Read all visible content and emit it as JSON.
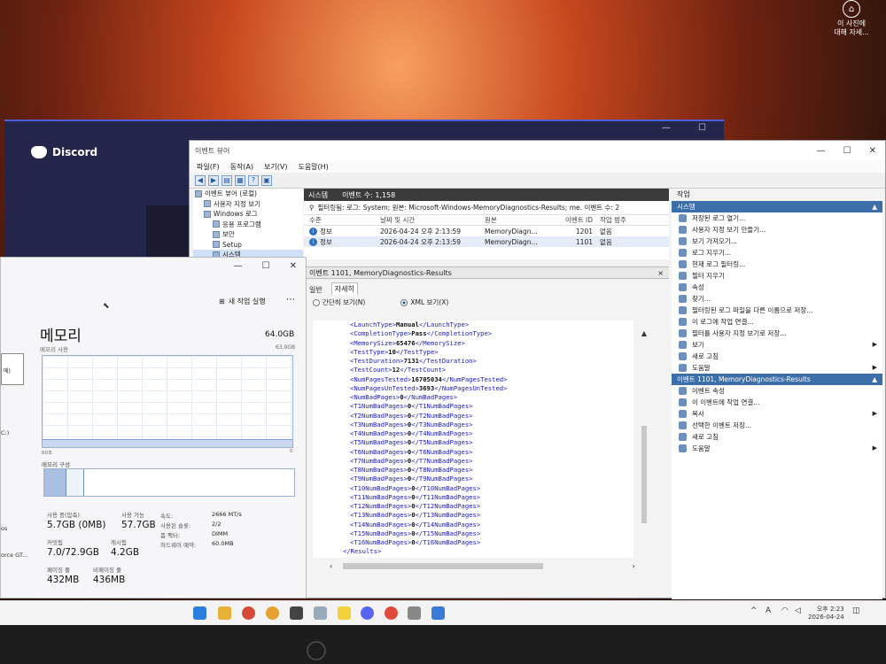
{
  "photo_caption": {
    "line1": "이 사진에",
    "line2": "대해 자세..."
  },
  "discord": {
    "app_name": "Discord"
  },
  "event_viewer": {
    "title": "이벤트 뷰어",
    "menu": [
      "파일(F)",
      "동작(A)",
      "보기(V)",
      "도움말(H)"
    ],
    "tree": [
      {
        "label": "이벤트 뷰어 (로컬)",
        "indent": 0,
        "selected": false
      },
      {
        "label": "사용자 지정 보기",
        "indent": 1,
        "selected": false
      },
      {
        "label": "Windows 로그",
        "indent": 1,
        "selected": false
      },
      {
        "label": "응용 프로그램",
        "indent": 2,
        "selected": false
      },
      {
        "label": "보안",
        "indent": 2,
        "selected": false
      },
      {
        "label": "Setup",
        "indent": 2,
        "selected": false
      },
      {
        "label": "시스템",
        "indent": 2,
        "selected": true
      }
    ],
    "section": {
      "name": "시스템",
      "count": "이벤트 수: 1,158"
    },
    "filter_text": "필터링됨: 로그: System; 원본: Microsoft-Windows-MemoryDiagnostics-Results; me. 이벤트 수: 2",
    "columns": [
      "수준",
      "날짜 및 시간",
      "원본",
      "이벤트 ID",
      "작업 범주"
    ],
    "rows": [
      {
        "level": "정보",
        "datetime": "2026-04-24 오후 2:13:59",
        "source": "MemoryDiagn...",
        "id": "1201",
        "category": "없음"
      },
      {
        "level": "정보",
        "datetime": "2026-04-24 오후 2:13:59",
        "source": "MemoryDiagn...",
        "id": "1101",
        "category": "없음"
      }
    ],
    "detail_title": "이벤트 1101, MemoryDiagnostics-Results",
    "detail_close": "×",
    "tabs": [
      "일반",
      "자세히"
    ],
    "view_modes": {
      "friendly": "간단히 보기(N)",
      "xml": "XML 보기(X)"
    },
    "xml_lines": [
      {
        "tag": "LaunchType",
        "value": "Manual"
      },
      {
        "tag": "CompletionType",
        "value": "Pass"
      },
      {
        "tag": "MemorySize",
        "value": "65476"
      },
      {
        "tag": "TestType",
        "value": "10"
      },
      {
        "tag": "TestDuration",
        "value": "7131"
      },
      {
        "tag": "TestCount",
        "value": "12"
      },
      {
        "tag": "NumPagesTested",
        "value": "16705034"
      },
      {
        "tag": "NumPagesUnTested",
        "value": "3693"
      },
      {
        "tag": "NumBadPages",
        "value": "0"
      },
      {
        "tag": "T1NumBadPages",
        "value": "0"
      },
      {
        "tag": "T2NumBadPages",
        "value": "0"
      },
      {
        "tag": "T3NumBadPages",
        "value": "0"
      },
      {
        "tag": "T4NumBadPages",
        "value": "0"
      },
      {
        "tag": "T5NumBadPages",
        "value": "0"
      },
      {
        "tag": "T6NumBadPages",
        "value": "0"
      },
      {
        "tag": "T7NumBadPages",
        "value": "0"
      },
      {
        "tag": "T8NumBadPages",
        "value": "0"
      },
      {
        "tag": "T9NumBadPages",
        "value": "0"
      },
      {
        "tag": "T10NumBadPages",
        "value": "0"
      },
      {
        "tag": "T11NumBadPages",
        "value": "0"
      },
      {
        "tag": "T12NumBadPages",
        "value": "0"
      },
      {
        "tag": "T13NumBadPages",
        "value": "0"
      },
      {
        "tag": "T14NumBadPages",
        "value": "0"
      },
      {
        "tag": "T15NumBadPages",
        "value": "0"
      },
      {
        "tag": "T16NumBadPages",
        "value": "0"
      }
    ],
    "xml_closing": "</Results>",
    "actions_title": "작업",
    "actions_section1": "시스템",
    "actions1": [
      {
        "label": "저장된 로그 열기...",
        "submenu": false
      },
      {
        "label": "사용자 지정 보기 만들기...",
        "submenu": false
      },
      {
        "label": "보기 가져오기...",
        "submenu": false
      },
      {
        "label": "로그 지우기...",
        "submenu": false
      },
      {
        "label": "현재 로그 필터링...",
        "submenu": false
      },
      {
        "label": "필터 지우기",
        "submenu": false
      },
      {
        "label": "속성",
        "submenu": false
      },
      {
        "label": "찾기...",
        "submenu": false
      },
      {
        "label": "필터링된 로그 파일을 다른 이름으로 저장...",
        "submenu": false
      },
      {
        "label": "이 로그에 작업 연결...",
        "submenu": false
      },
      {
        "label": "필터를 사용자 지정 보기로 저장...",
        "submenu": false
      },
      {
        "label": "보기",
        "submenu": true
      },
      {
        "label": "새로 고침",
        "submenu": false
      },
      {
        "label": "도움말",
        "submenu": true
      }
    ],
    "actions_section2": "이벤트 1101, MemoryDiagnostics-Results",
    "actions2": [
      {
        "label": "이벤트 속성",
        "submenu": false
      },
      {
        "label": "이 이벤트에 작업 연결...",
        "submenu": false
      },
      {
        "label": "복사",
        "submenu": true
      },
      {
        "label": "선택한 이벤트 저장...",
        "submenu": false
      },
      {
        "label": "새로 고침",
        "submenu": false
      },
      {
        "label": "도움말",
        "submenu": true
      }
    ]
  },
  "task_manager": {
    "new_task": "새 작업 실행",
    "heading": "메모리",
    "total": "64.0GB",
    "usage_label": "메모리 사용",
    "usage_max": "63.9GB",
    "axis_left": "60초",
    "axis_right": "0",
    "composition_label": "메모리 구성",
    "usage_fraction": 0.09,
    "stats": [
      {
        "label": "사용 중(압축)",
        "value": "5.7GB (0MB)"
      },
      {
        "label": "사용 가능",
        "value": "57.7GB"
      },
      {
        "label": "커밋됨",
        "value": "7.0/72.9GB"
      },
      {
        "label": "캐시됨",
        "value": "4.2GB"
      },
      {
        "label": "페이징 풀",
        "value": "432MB"
      },
      {
        "label": "비페이징 풀",
        "value": "436MB"
      }
    ],
    "specs": [
      {
        "label": "속도:",
        "value": "2666 MT/s"
      },
      {
        "label": "사용된 슬롯:",
        "value": "2/2"
      },
      {
        "label": "폼 팩터:",
        "value": "DIMM"
      },
      {
        "label": "하드웨어 예약:",
        "value": "60.0MB"
      }
    ],
    "left_partial": [
      "메)",
      "C:)",
      "os",
      "orce GT..."
    ]
  },
  "taskbar": {
    "tray_chevron": "^",
    "ime": "A",
    "clock_time": "오후 2:23",
    "clock_date": "2026-04-24"
  }
}
